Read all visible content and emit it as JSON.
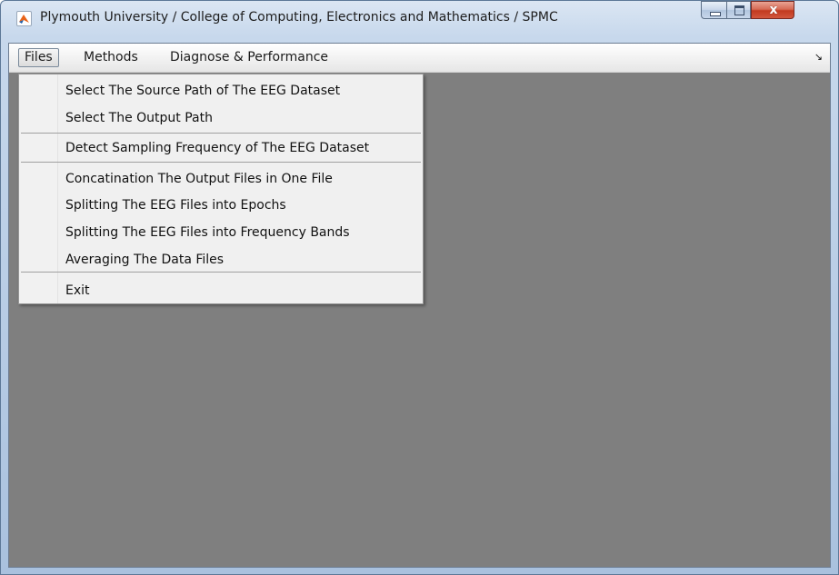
{
  "window": {
    "title": "Plymouth University / College of Computing, Electronics and Mathematics / SPMC",
    "icon": "matlab-icon",
    "controls": {
      "minimize": "minimize-icon",
      "maximize": "maximize-icon",
      "close": "x"
    }
  },
  "menubar": {
    "items": [
      {
        "label": "Files"
      },
      {
        "label": "Methods"
      },
      {
        "label": "Diagnose & Performance"
      }
    ],
    "overflow_glyph": "↘"
  },
  "files_menu": {
    "items": [
      {
        "label": "Select The Source Path of The EEG Dataset"
      },
      {
        "label": "Select The Output Path"
      },
      {
        "label": "Detect Sampling Frequency of The EEG Dataset"
      },
      {
        "label": "Concatination The Output Files in One File"
      },
      {
        "label": "Splitting The EEG Files into Epochs"
      },
      {
        "label": "Splitting The EEG Files into Frequency Bands"
      },
      {
        "label": "Averaging The Data Files"
      },
      {
        "label": "Exit"
      }
    ]
  },
  "colors": {
    "client_background": "#7f7f7f",
    "menu_background": "#f0f0f0",
    "close_button": "#c23a1f"
  }
}
